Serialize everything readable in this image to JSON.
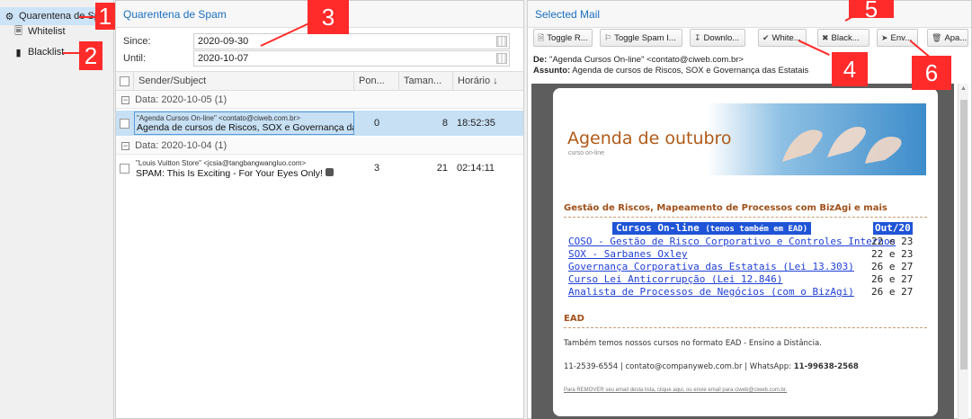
{
  "nav": {
    "items": [
      {
        "label": "Quarentena de Spam",
        "icon": "quarantine-icon"
      },
      {
        "label": "Whitelist",
        "icon": "document-outline-icon"
      },
      {
        "label": "Blacklist",
        "icon": "document-filled-icon"
      }
    ]
  },
  "spam": {
    "title": "Quarentena de Spam",
    "since_label": "Since:",
    "since_value": "2020-09-30",
    "until_label": "Until:",
    "until_value": "2020-10-07",
    "columns": {
      "sender": "Sender/Subject",
      "points": "Pon...",
      "size": "Taman...",
      "time": "Horário ↓"
    },
    "groups": [
      {
        "label": "Data: 2020-10-05 (1)"
      },
      {
        "label": "Data: 2020-10-04 (1)"
      }
    ],
    "rows": [
      {
        "from": "\"Agenda Cursos On-line\" <contato@ciweb.com.br>",
        "subject": "Agenda de cursos de Riscos, SOX e Governança das...",
        "points": "0",
        "size": "8",
        "time": "18:52:35"
      },
      {
        "from": "\"Louis Vuitton Store\" <jcsia@tangbangwangluo.com>",
        "subject": "SPAM: This Is Exciting - For Your Eyes Only!",
        "points": "3",
        "size": "21",
        "time": "02:14:11"
      }
    ]
  },
  "selected": {
    "title": "Selected Mail",
    "toolbar": {
      "toggle_read": "Toggle R...",
      "toggle_spam": "Toggle Spam I...",
      "download": "Downlo...",
      "whitelist": "White...",
      "blacklist": "Black...",
      "send": "Env...",
      "delete": "Apa..."
    },
    "from_label": "De:",
    "from_value": "\"Agenda Cursos On-line\" <contato@ciweb.com.br>",
    "subject_label": "Assunto:",
    "subject_value": "Agenda de cursos de Riscos, SOX e Governança das Estatais"
  },
  "email": {
    "banner_title": "Agenda de outubro",
    "banner_sub": "curso on-line",
    "section1": "Gestão de Riscos, Mapeamento de Processos com BizAgi e mais",
    "courses_head": "Cursos On-line",
    "courses_head_small": "(temos também em EAD)",
    "month_head": "Out/20",
    "courses": [
      {
        "name": "COSO - Gestão de Risco Corporativo e Controles Internos",
        "date": "22 e 23"
      },
      {
        "name": "SOX - Sarbanes Oxley",
        "date": "22 e 23"
      },
      {
        "name": "Governança Corporativa das Estatais (Lei 13.303)",
        "date": "26 e 27"
      },
      {
        "name": "Curso Lei Anticorrupção (Lei 12.846)",
        "date": "26 e 27"
      },
      {
        "name": "Analista de Processos de Negócios (com o BizAgi)",
        "date": "26 e 27"
      }
    ],
    "section2": "EAD",
    "ead_text": "Também temos nossos cursos no formato EAD - Ensino a Distância.",
    "contact_text": "11-2539-6554 | contato@companyweb.com.br | WhatsApp:",
    "whatsapp": "11-99638-2568",
    "remove_text": "Para REMOVER seu email desta lista, clique aqui, ou envie email para ciweb@ciweb.com.br."
  },
  "callouts": [
    "1",
    "2",
    "3",
    "4",
    "5",
    "6"
  ]
}
